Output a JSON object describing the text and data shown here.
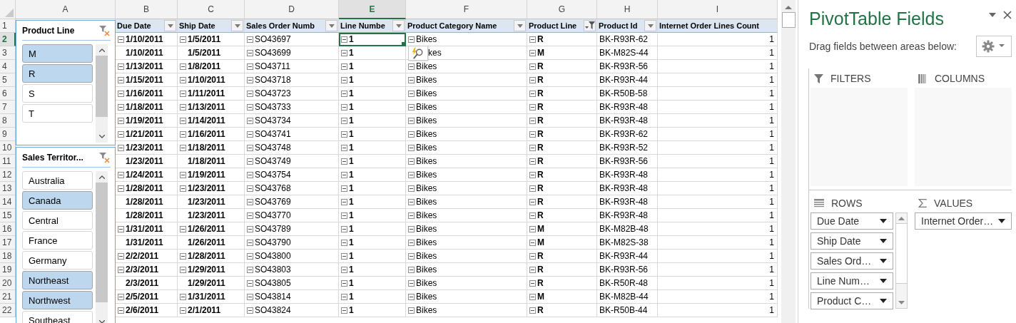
{
  "sheet": {
    "columns": [
      {
        "label": "A",
        "selected": false
      },
      {
        "label": "B",
        "selected": false
      },
      {
        "label": "C",
        "selected": false
      },
      {
        "label": "D",
        "selected": false
      },
      {
        "label": "E",
        "selected": true
      },
      {
        "label": "F",
        "selected": false
      },
      {
        "label": "G",
        "selected": false
      },
      {
        "label": "H",
        "selected": false
      },
      {
        "label": "I",
        "selected": false
      }
    ],
    "row_headers": [
      {
        "label": "1",
        "selected": false
      },
      {
        "label": "2",
        "selected": true
      },
      {
        "label": "3",
        "selected": false
      },
      {
        "label": "4",
        "selected": false
      },
      {
        "label": "5",
        "selected": false
      },
      {
        "label": "6",
        "selected": false
      },
      {
        "label": "7",
        "selected": false
      },
      {
        "label": "8",
        "selected": false
      },
      {
        "label": "9",
        "selected": false
      },
      {
        "label": "10",
        "selected": false
      },
      {
        "label": "11",
        "selected": false
      },
      {
        "label": "12",
        "selected": false
      },
      {
        "label": "13",
        "selected": false
      },
      {
        "label": "14",
        "selected": false
      },
      {
        "label": "15",
        "selected": false
      },
      {
        "label": "16",
        "selected": false
      },
      {
        "label": "17",
        "selected": false
      },
      {
        "label": "18",
        "selected": false
      },
      {
        "label": "19",
        "selected": false
      },
      {
        "label": "20",
        "selected": false
      },
      {
        "label": "21",
        "selected": false
      },
      {
        "label": "22",
        "selected": false
      }
    ],
    "quick_analysis": true
  },
  "table": {
    "headers": [
      {
        "label": "Due Date",
        "kind": "dropdown"
      },
      {
        "label": "Ship Date",
        "kind": "dropdown"
      },
      {
        "label": "Sales Order Numb",
        "kind": "dropdown"
      },
      {
        "label": "Line Numbe",
        "kind": "dropdown"
      },
      {
        "label": "Product Category Name",
        "kind": "dropdown"
      },
      {
        "label": "Product Line",
        "kind": "filter"
      },
      {
        "label": "Product Id",
        "kind": "dropdown"
      },
      {
        "label": "Internet Order Lines Count",
        "kind": "plain"
      }
    ],
    "rows": [
      {
        "due": "1/10/2011",
        "ship": "1/5/2011",
        "toggle": true,
        "order": "SO43697",
        "line": "1",
        "category": "Bikes",
        "product_line": "R",
        "product_id": "BK-R93R-62",
        "count": "1"
      },
      {
        "due": "1/10/2011",
        "ship": "1/5/2011",
        "toggle": false,
        "order": "SO43699",
        "line": "1",
        "category": "kes",
        "covered": true,
        "product_line": "M",
        "product_id": "BK-M82S-44",
        "count": "1"
      },
      {
        "due": "1/13/2011",
        "ship": "1/8/2011",
        "toggle": true,
        "order": "SO43711",
        "line": "1",
        "category": "Bikes",
        "product_line": "R",
        "product_id": "BK-R93R-56",
        "count": "1"
      },
      {
        "due": "1/15/2011",
        "ship": "1/10/2011",
        "toggle": true,
        "order": "SO43718",
        "line": "1",
        "category": "Bikes",
        "product_line": "R",
        "product_id": "BK-R93R-44",
        "count": "1"
      },
      {
        "due": "1/16/2011",
        "ship": "1/11/2011",
        "toggle": true,
        "order": "SO43723",
        "line": "1",
        "category": "Bikes",
        "product_line": "R",
        "product_id": "BK-R50B-58",
        "count": "1"
      },
      {
        "due": "1/18/2011",
        "ship": "1/13/2011",
        "toggle": true,
        "order": "SO43733",
        "line": "1",
        "category": "Bikes",
        "product_line": "R",
        "product_id": "BK-R93R-48",
        "count": "1"
      },
      {
        "due": "1/19/2011",
        "ship": "1/14/2011",
        "toggle": true,
        "order": "SO43734",
        "line": "1",
        "category": "Bikes",
        "product_line": "R",
        "product_id": "BK-R93R-48",
        "count": "1"
      },
      {
        "due": "1/21/2011",
        "ship": "1/16/2011",
        "toggle": true,
        "order": "SO43741",
        "line": "1",
        "category": "Bikes",
        "product_line": "R",
        "product_id": "BK-R93R-62",
        "count": "1"
      },
      {
        "due": "1/23/2011",
        "ship": "1/18/2011",
        "toggle": true,
        "order": "SO43748",
        "line": "1",
        "category": "Bikes",
        "product_line": "R",
        "product_id": "BK-R93R-52",
        "count": "1"
      },
      {
        "due": "1/23/2011",
        "ship": "1/18/2011",
        "toggle": false,
        "order": "SO43749",
        "line": "1",
        "category": "Bikes",
        "product_line": "R",
        "product_id": "BK-R93R-56",
        "count": "1"
      },
      {
        "due": "1/24/2011",
        "ship": "1/19/2011",
        "toggle": true,
        "order": "SO43754",
        "line": "1",
        "category": "Bikes",
        "product_line": "R",
        "product_id": "BK-R93R-48",
        "count": "1"
      },
      {
        "due": "1/28/2011",
        "ship": "1/23/2011",
        "toggle": true,
        "order": "SO43768",
        "line": "1",
        "category": "Bikes",
        "product_line": "R",
        "product_id": "BK-R93R-48",
        "count": "1"
      },
      {
        "due": "1/28/2011",
        "ship": "1/23/2011",
        "toggle": false,
        "order": "SO43769",
        "line": "1",
        "category": "Bikes",
        "product_line": "R",
        "product_id": "BK-R93R-48",
        "count": "1"
      },
      {
        "due": "1/28/2011",
        "ship": "1/23/2011",
        "toggle": false,
        "order": "SO43770",
        "line": "1",
        "category": "Bikes",
        "product_line": "R",
        "product_id": "BK-R93R-48",
        "count": "1"
      },
      {
        "due": "1/31/2011",
        "ship": "1/26/2011",
        "toggle": true,
        "order": "SO43789",
        "line": "1",
        "category": "Bikes",
        "product_line": "M",
        "product_id": "BK-M82B-48",
        "count": "1"
      },
      {
        "due": "1/31/2011",
        "ship": "1/26/2011",
        "toggle": false,
        "order": "SO43790",
        "line": "1",
        "category": "Bikes",
        "product_line": "M",
        "product_id": "BK-M82S-38",
        "count": "1"
      },
      {
        "due": "2/2/2011",
        "ship": "1/28/2011",
        "toggle": true,
        "order": "SO43800",
        "line": "1",
        "category": "Bikes",
        "product_line": "R",
        "product_id": "BK-R93R-44",
        "count": "1"
      },
      {
        "due": "2/3/2011",
        "ship": "1/29/2011",
        "toggle": true,
        "order": "SO43803",
        "line": "1",
        "category": "Bikes",
        "product_line": "R",
        "product_id": "BK-R93R-56",
        "count": "1"
      },
      {
        "due": "2/3/2011",
        "ship": "1/29/2011",
        "toggle": false,
        "order": "SO43805",
        "line": "1",
        "category": "Bikes",
        "product_line": "R",
        "product_id": "BK-R50R-48",
        "count": "1"
      },
      {
        "due": "2/5/2011",
        "ship": "1/31/2011",
        "toggle": true,
        "order": "SO43814",
        "line": "1",
        "category": "Bikes",
        "product_line": "M",
        "product_id": "BK-M82B-44",
        "count": "1"
      },
      {
        "due": "2/6/2011",
        "ship": "2/1/2011",
        "toggle": true,
        "order": "SO43824",
        "line": "1",
        "category": "Bikes",
        "product_line": "R",
        "product_id": "BK-R50B-44",
        "count": "1"
      }
    ]
  },
  "slicers": [
    {
      "title": "Product Line",
      "items": [
        {
          "label": "M",
          "selected": true
        },
        {
          "label": "R",
          "selected": true
        },
        {
          "label": "S",
          "selected": false
        },
        {
          "label": "T",
          "selected": false
        }
      ]
    },
    {
      "title": "Sales Territor...",
      "items": [
        {
          "label": "Australia",
          "selected": false
        },
        {
          "label": "Canada",
          "selected": true
        },
        {
          "label": "Central",
          "selected": false
        },
        {
          "label": "France",
          "selected": false
        },
        {
          "label": "Germany",
          "selected": false
        },
        {
          "label": "Northeast",
          "selected": true
        },
        {
          "label": "Northwest",
          "selected": true
        },
        {
          "label": "Southeast",
          "selected": false
        }
      ]
    }
  ],
  "pivot_fields": {
    "title": "PivotTable Fields",
    "hint": "Drag fields between areas below:",
    "areas": [
      {
        "kind": "filters",
        "label": "FILTERS"
      },
      {
        "kind": "columns",
        "label": "COLUMNS"
      },
      {
        "kind": "rows",
        "label": "ROWS",
        "fields": [
          "Due Date",
          "Ship Date",
          "Sales Ord…",
          "Line Num…",
          "Product C…"
        ]
      },
      {
        "kind": "values",
        "label": "VALUES",
        "fields": [
          "Internet Order…"
        ]
      }
    ]
  }
}
